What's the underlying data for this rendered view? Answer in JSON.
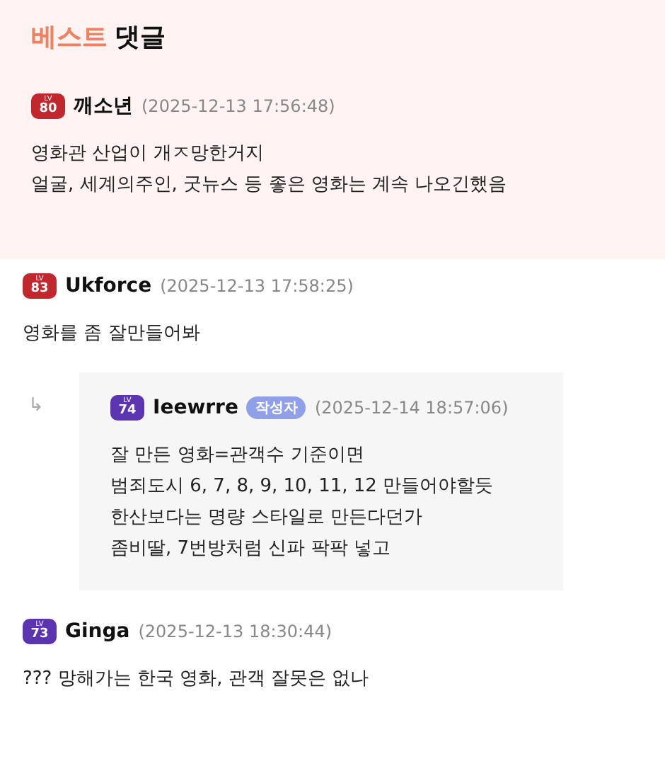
{
  "best_section": {
    "title_highlight": "베스트",
    "title_rest": "댓글",
    "comment": {
      "level": "80",
      "level_prefix": "LV",
      "color": "#c0282e",
      "user": "깨소년",
      "time": "(2025-12-13 17:56:48)",
      "lines": [
        "영화관 산업이 개ㅈ망한거지",
        "얼굴, 세계의주인, 굿뉴스 등 좋은 영화는 계속 나오긴했음"
      ]
    }
  },
  "comments": [
    {
      "level": "83",
      "level_prefix": "LV",
      "color": "#c0282e",
      "user": "Ukforce",
      "time": "(2025-12-13 17:58:25)",
      "lines": [
        "영화를 좀 잘만들어봐"
      ],
      "replies": [
        {
          "arrow": "↳",
          "level": "74",
          "level_prefix": "LV",
          "color": "#5b35b0",
          "user": "Ieewrre",
          "author_tag": "작성자",
          "time": "(2025-12-14 18:57:06)",
          "lines": [
            "잘 만든 영화=관객수 기준이면",
            "범죄도시 6, 7, 8, 9, 10, 11, 12 만들어야할듯",
            "한산보다는 명량 스타일로 만든다던가",
            "좀비딸, 7번방처럼 신파 팍팍 넣고"
          ]
        }
      ]
    },
    {
      "level": "73",
      "level_prefix": "LV",
      "color": "#5b35b0",
      "user": "Ginga",
      "time": "(2025-12-13 18:30:44)",
      "lines": [
        "??? 망해가는 한국 영화, 관객 잘못은 없나"
      ]
    }
  ]
}
